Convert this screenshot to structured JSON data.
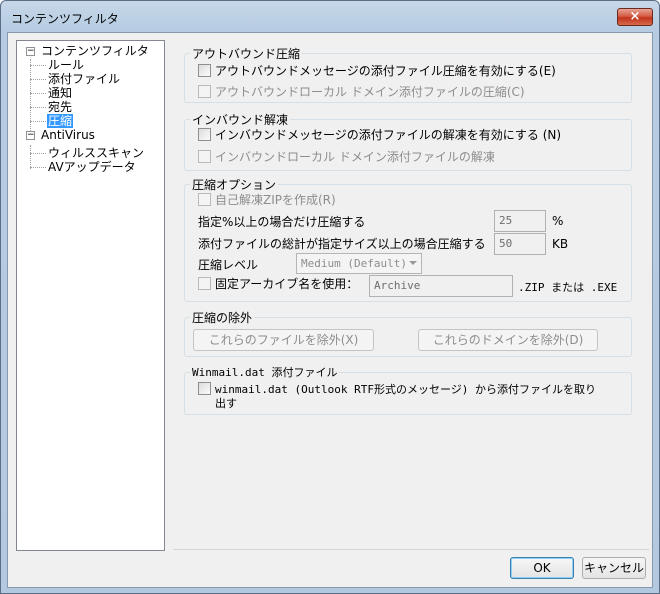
{
  "window": {
    "title": "コンテンツフィルタ",
    "close_label": "×"
  },
  "tree": {
    "root1": "コンテンツフィルタ",
    "children1": [
      "ルール",
      "添付ファイル",
      "通知",
      "宛先",
      "圧縮"
    ],
    "root2": "AntiVirus",
    "children2": [
      "ウィルススキャン",
      "AVアップデータ"
    ],
    "expander": "−"
  },
  "outbound": {
    "title": "アウトバウンド圧縮",
    "enable": "アウトバウンドメッセージの添付ファイル圧縮を有効にする(E)",
    "local": "アウトバウンドローカル ドメイン添付ファイルの圧縮(C)"
  },
  "inbound": {
    "title": "インバウンド解凍",
    "enable": "インバウンドメッセージの添付ファイルの解凍を有効にする (N)",
    "local": "インバウンドローカル ドメイン添付ファイルの解凍"
  },
  "options": {
    "title": "圧縮オプション",
    "sfx": "自己解凍ZIPを作成(R)",
    "threshold_label": "指定%以上の場合だけ圧縮する",
    "threshold_value": "25",
    "threshold_unit": "%",
    "size_label": "添付ファイルの総計が指定サイズ以上の場合圧縮する",
    "size_value": "50",
    "size_unit": "KB",
    "level_label": "圧縮レベル",
    "level_value": "Medium (Default)",
    "fixed_name": "固定アーカイブ名を使用：",
    "fixed_name_value": "Archive",
    "ext_note": ".ZIP または .EXE"
  },
  "exclusions": {
    "title": "圧縮の除外",
    "files_button": "これらのファイルを除外(X)",
    "domains_button": "これらのドメインを除外(D)"
  },
  "winmail": {
    "title": "Winmail.dat 添付ファイル",
    "line1": "winmail.dat (Outlook RTF形式のメッセージ) から添付ファイルを取り",
    "line2": "出す"
  },
  "footer": {
    "ok": "OK",
    "cancel": "キャンセル"
  }
}
